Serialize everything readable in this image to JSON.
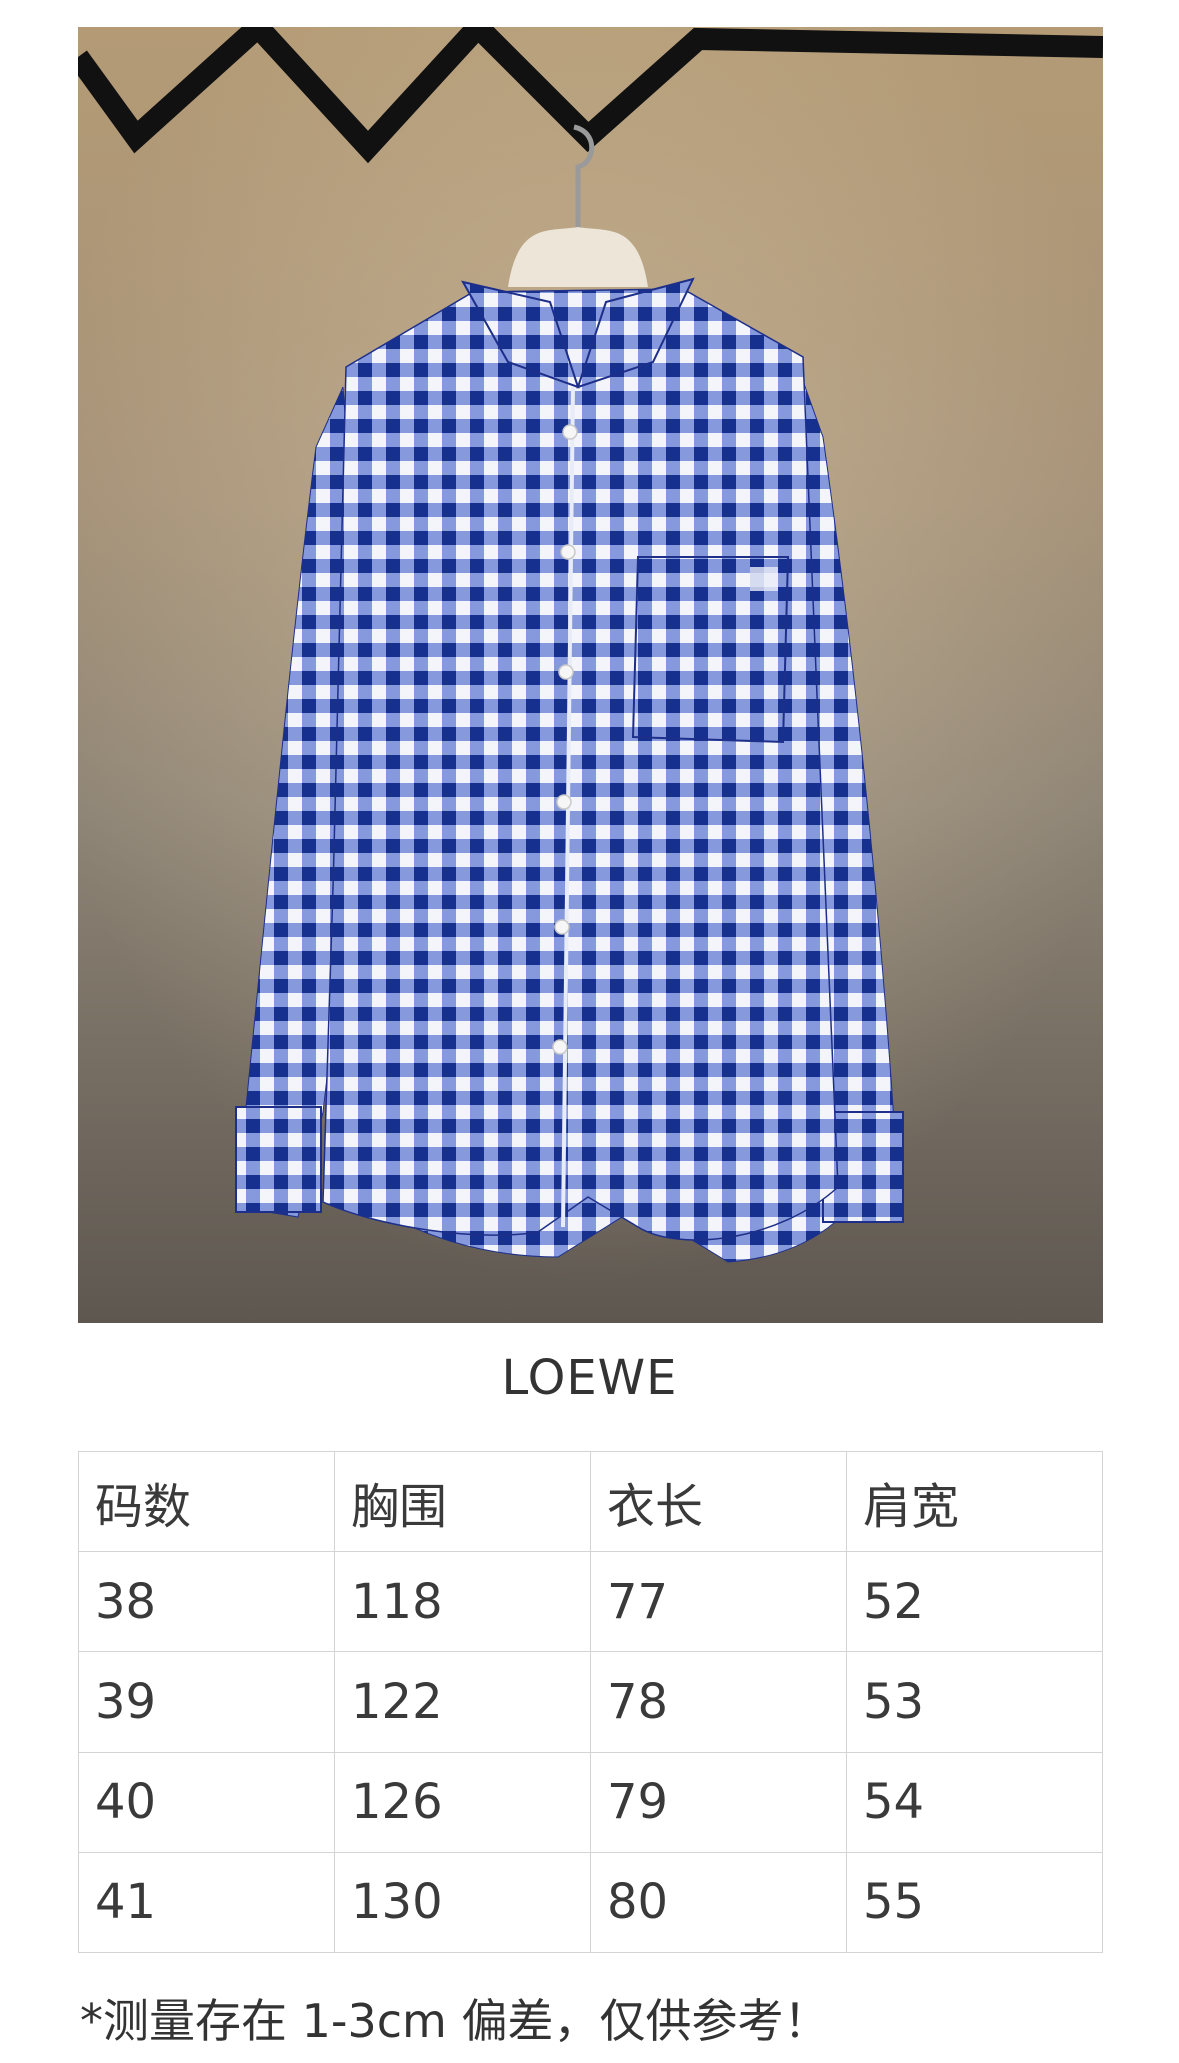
{
  "brand": "LOEWE",
  "table": {
    "headers": [
      "码数",
      "胸围",
      "衣长",
      "肩宽"
    ],
    "rows": [
      [
        "38",
        "118",
        "77",
        "52"
      ],
      [
        "39",
        "122",
        "78",
        "53"
      ],
      [
        "40",
        "126",
        "79",
        "54"
      ],
      [
        "41",
        "130",
        "80",
        "55"
      ]
    ]
  },
  "note": "*测量存在 1-3cm 偏差，仅供参考！",
  "colors": {
    "check_blue": "#1f3fb0",
    "background_gold": "#a58c6a",
    "hanger": "#e8e0d2"
  }
}
